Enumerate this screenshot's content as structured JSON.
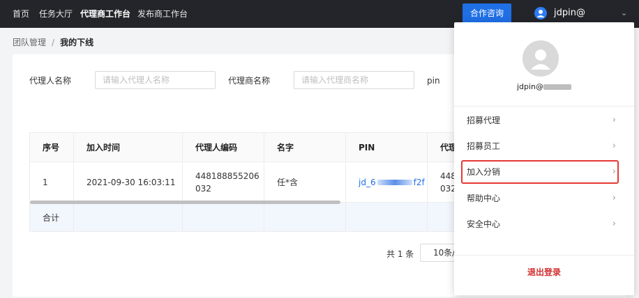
{
  "nav": {
    "items": [
      "首页",
      "任务大厅",
      "代理商工作台",
      "发布商工作台"
    ],
    "active_index": 2,
    "consult_button": "合作咨询",
    "user_name": "jdpin@"
  },
  "breadcrumb": {
    "parent": "团队管理",
    "separator": "/",
    "current": "我的下线"
  },
  "filters": {
    "agent_name_label": "代理人名称",
    "agent_name_placeholder": "请输入代理人名称",
    "agency_name_label": "代理商名称",
    "agency_name_placeholder": "请输入代理商名称",
    "pin_label": "pin"
  },
  "table": {
    "columns": [
      "序号",
      "加入时间",
      "代理人编码",
      "名字",
      "PIN",
      "代理"
    ],
    "rows": [
      {
        "index": "1",
        "join_time": "2021-09-30 16:03:11",
        "agent_code": "448188855206 032",
        "name": "任*含",
        "pin": "jd_6",
        "pin_tail": "f2f",
        "agency": "448 032"
      }
    ],
    "summary_label": "合计"
  },
  "pagination": {
    "total": "共 1 条",
    "page_size": "10条/"
  },
  "dropdown": {
    "username": "jdpin@",
    "items": [
      {
        "label": "招募代理"
      },
      {
        "label": "招募员工"
      },
      {
        "label": "加入分销"
      },
      {
        "label": "帮助中心"
      },
      {
        "label": "安全中心"
      }
    ],
    "highlighted_item": "加入分销",
    "logout": "退出登录"
  },
  "colors": {
    "topbar": "#24252a",
    "accent": "#1f6fe5",
    "highlight_border": "#e53935",
    "logout": "#d32f2f"
  }
}
